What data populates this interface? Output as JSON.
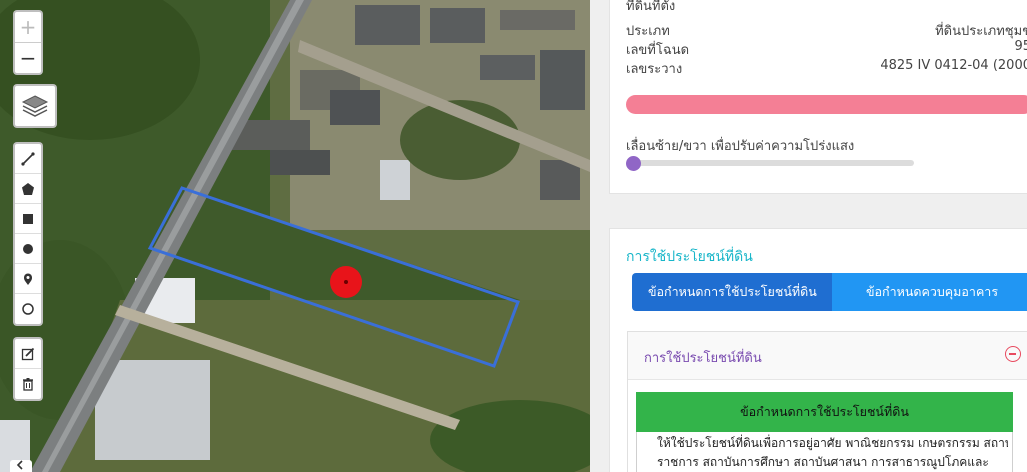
{
  "map": {
    "zoom_in": "+",
    "zoom_out": "−",
    "icons": {
      "layers": "layers-icon",
      "polyline": "polyline-icon",
      "polygon": "polygon-icon",
      "rectangle": "rectangle-icon",
      "circle": "circle-icon",
      "marker": "marker-icon",
      "circlemarker": "circle-marker-icon",
      "edit": "edit-icon",
      "delete": "trash-icon"
    },
    "parcel_color": "#3a6fd8",
    "pin_color": "#e8141a"
  },
  "info": {
    "rows": [
      {
        "label": "ที่ดินที่ตั้ง",
        "value": ""
      },
      {
        "label": "ประเภท",
        "value": "ที่ดินประเภทชุมช"
      },
      {
        "label": "เลขที่โฉนด",
        "value": "95"
      },
      {
        "label": "เลขระวาง",
        "value": "4825 IV 0412-04 (2000"
      }
    ],
    "opacity_label": "เลื่อนซ้าย/ขวา เพื่อปรับค่าความโปร่งแสง",
    "opacity_value": 0
  },
  "landuse": {
    "title": "การใช้ประโยชน์ที่ดิน",
    "tabs": [
      {
        "label": "ข้อกำหนดการใช้ประโยชน์ที่ดิน"
      },
      {
        "label": "ข้อกำหนดควบคุมอาคาร"
      }
    ],
    "accordion_title": "การใช้ประโยชน์ที่ดิน",
    "rule_header": "ข้อกำหนดการใช้ประโยชน์ที่ดิน",
    "rule_lines": [
      "ให้ใช้ประโยชน์ที่ดินเพื่อการอยู่อาศัย พาณิชยกรรม เกษตรกรรม สถาบัน",
      "ราชการ สถาบันการศึกษา สถาบันศาสนา การสาธารณูปโภคและ"
    ]
  },
  "colors": {
    "accent_red": "#f47f95",
    "tab_active": "#1f6ed1",
    "tab_inactive": "#2196f3",
    "rule_header": "#33b44a",
    "title_teal": "#19b6c9",
    "accordion_purple": "#7a4cb0"
  }
}
